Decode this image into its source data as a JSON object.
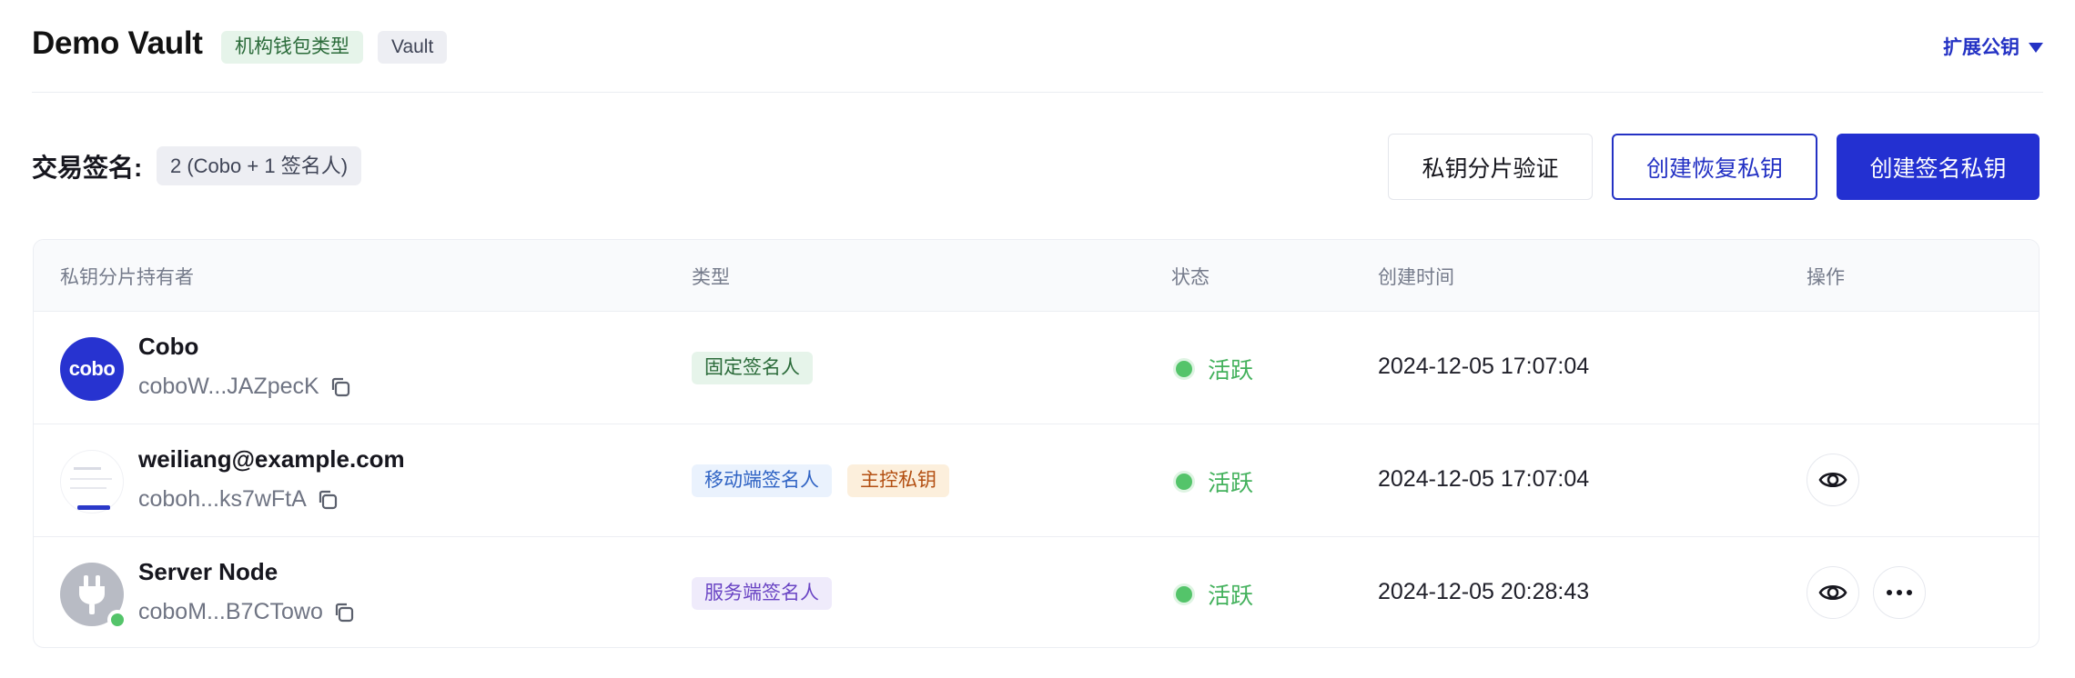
{
  "header": {
    "title": "Demo Vault",
    "wallet_type_tag": "机构钱包类型",
    "vault_tag": "Vault",
    "expand_pubkey_label": "扩展公钥"
  },
  "signing": {
    "label": "交易签名:",
    "badge": "2 (Cobo + 1 签名人)"
  },
  "actions": {
    "verify_label": "私钥分片验证",
    "create_recovery_label": "创建恢复私钥",
    "create_signing_label": "创建签名私钥"
  },
  "table": {
    "columns": [
      "私钥分片持有者",
      "类型",
      "状态",
      "创建时间",
      "操作"
    ],
    "rows": [
      {
        "avatar_text": "cobo",
        "name": "Cobo",
        "address": "coboW...JAZpecK",
        "types": [
          "固定签名人"
        ],
        "status": "活跃",
        "created": "2024-12-05 17:07:04"
      },
      {
        "name": "weiliang@example.com",
        "address": "coboh...ks7wFtA",
        "types": [
          "移动端签名人",
          "主控私钥"
        ],
        "status": "活跃",
        "created": "2024-12-05 17:07:04"
      },
      {
        "name": "Server Node",
        "address": "coboM...B7CTowo",
        "types": [
          "服务端签名人"
        ],
        "status": "活跃",
        "created": "2024-12-05 20:28:43"
      }
    ]
  },
  "colors": {
    "accent": "#2330d1",
    "active_green": "#54c46a"
  },
  "icons": [
    "caret-down-icon",
    "copy-icon",
    "eye-icon",
    "more-icon",
    "plug-icon"
  ]
}
